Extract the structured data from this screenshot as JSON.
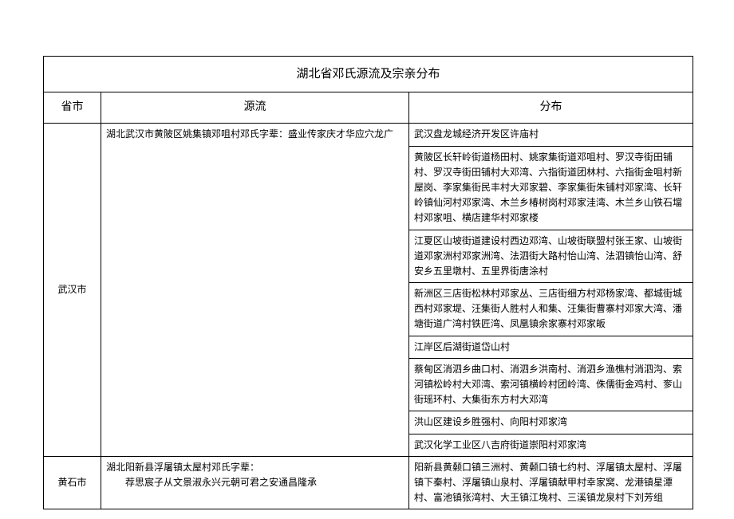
{
  "title": "湖北省邓氏源流及宗亲分布",
  "columns": {
    "province": "省市",
    "origin": "源流",
    "distribution": "分布"
  },
  "rows": [
    {
      "province": "武汉市",
      "origin": "湖北武汉市黄陂区姚集镇邓咀村邓氏字辈：盛业传家庆才华应穴龙广",
      "distributions": [
        "武汉盘龙城经济开发区许庙村",
        "黄陂区长轩岭街道杨田村、姚家集街道邓咀村、罗汉寺街田铺村、罗汉寺街田铺村大邓湾、六指街道团林村、六指街金咀村新屋岗、李家集街民丰村大邓家碧、李家集街朱铺村邓家湾、长轩岭镇仙河村邓家湾、木兰乡椿树岗村邓家洼湾、木兰乡山铁石壋村邓家咀、横店建华村邓家楼",
        "江夏区山坡街道建设村西边邓湾、山坡街联盟村张王家、山坡街道邓家洲村邓家洲湾、法泗街大路村怡山湾、法泗镇怡山湾、舒安乡五里墩村、五里界街唐涂村",
        "新洲区三店街松林村邓家丛、三店街细方村邓杨家湾、都城街城西村邓家堤、汪集街人胜村人和集、汪集街曹寨村邓家大湾、潘塘街道广湾村铁匠湾、凤凰镇余家寨村邓家皈",
        "江岸区后湖街道岱山村",
        "蔡甸区消泗乡曲口村、消泗乡洪南村、消泗乡渔樵村消泗沟、索河镇松岭村大邓湾、索河镇横岭村团岭湾、侏儒街金鸡村、奓山街瑶环村、大集街东方村大邓湾",
        "洪山区建设乡胜强村、向阳村邓家湾",
        "武汉化学工业区八吉府街道崇阳村邓家湾"
      ]
    },
    {
      "province": "黄石市",
      "origin_lines": [
        "湖北阳新县浮屠镇太屋村邓氏字辈：",
        "荐思宸子从文景淑永兴元朝可君之安通昌隆承"
      ],
      "distributions": [
        "阳新县黄颡口镇三洲村、黄颡口镇七约村、浮屠镇太屋村、浮屠镇下秦村、浮屠镇山泉村、浮屠镇献甲村幸家窝、龙港镇星潭村、富池镇张湾村、大王镇江堍村、三溪镇龙泉村下刘芳组"
      ]
    }
  ]
}
